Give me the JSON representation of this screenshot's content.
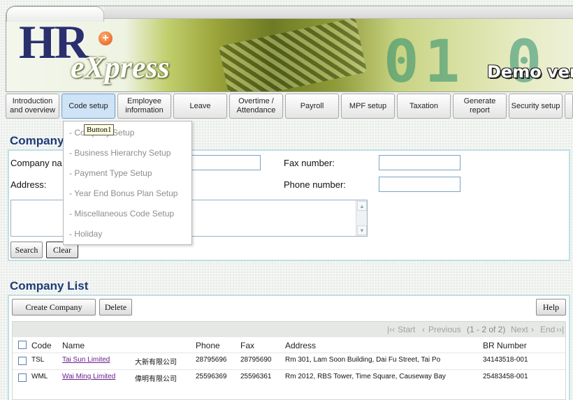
{
  "banner": {
    "logo_hr": "HR",
    "logo_plus": "+",
    "logo_express": "eXpress",
    "demo_text": "Demo vers",
    "colors": {
      "logo_navy": "#2a2f6e",
      "accent_green": "#8f9a39"
    }
  },
  "nav": {
    "items": [
      {
        "label": "Introduction\nand overview"
      },
      {
        "label": "Code setup",
        "active": true
      },
      {
        "label": "Employee\ninformation"
      },
      {
        "label": "Leave"
      },
      {
        "label": "Overtime /\nAttendance"
      },
      {
        "label": "Payroll"
      },
      {
        "label": "MPF setup"
      },
      {
        "label": "Taxation"
      },
      {
        "label": "Generate report"
      },
      {
        "label": "Security setup"
      }
    ]
  },
  "dropdown": {
    "items": [
      "- Company Setup",
      "- Business Hierarchy Setup",
      "- Payment Type Setup",
      "- Year End Bonus Plan Setup",
      "- Miscellaneous Code Setup",
      "- Holiday"
    ],
    "tooltip": "Button1"
  },
  "search": {
    "title": "Company",
    "company_name_label": "Company na",
    "address_label": "Address:",
    "fax_label": "Fax number:",
    "phone_label": "Phone number:",
    "company_name_value": "",
    "fax_value": "",
    "phone_value": "",
    "address_value": "",
    "search_button": "Search",
    "clear_button": "Clear"
  },
  "company_list": {
    "title": "Company List",
    "create_button": "Create Company",
    "delete_button": "Delete",
    "help_button": "Help",
    "pager": {
      "start": "Start",
      "previous": "Previous",
      "range": "(1 - 2 of 2)",
      "next": "Next",
      "end": "End"
    },
    "columns": [
      "Code",
      "Name",
      "Phone",
      "Fax",
      "Address",
      "BR Number"
    ],
    "rows": [
      {
        "code": "TSL",
        "name": "Tai Sun Limited",
        "chinese_name": "大新有限公司",
        "phone": "28795696",
        "fax": "28795690",
        "address": "Rm 301, Lam Soon Building, Dai Fu Street, Tai Po",
        "br_number": "34143518-001"
      },
      {
        "code": "WML",
        "name": "Wai Ming Limited",
        "chinese_name": "偉明有限公司",
        "phone": "25596369",
        "fax": "25596361",
        "address": "Rm 2012, RBS Tower, Time Square, Causeway Bay",
        "br_number": "25483458-001"
      }
    ]
  }
}
